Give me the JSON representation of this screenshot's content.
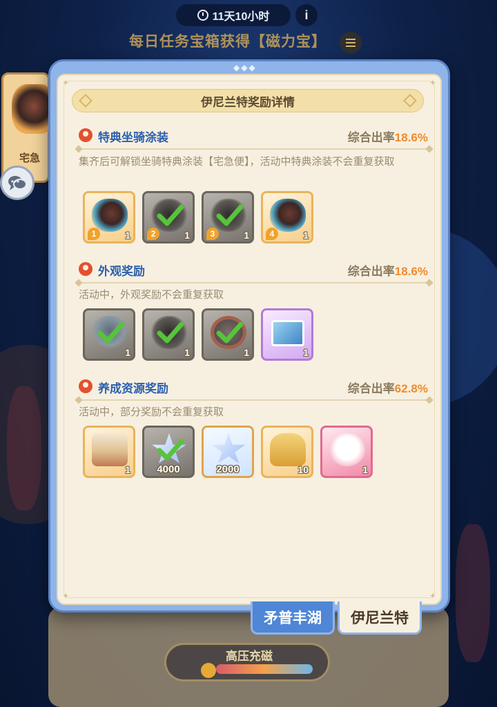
{
  "background": {
    "timer": "11天10小时",
    "info_glyph": "i",
    "title": "每日任务宝箱获得【磁力宝】",
    "side_card_label": "宅急",
    "bottom_button_label": "高压充磁"
  },
  "modal": {
    "title": "伊尼兰特奖励详情",
    "sections": [
      {
        "title": "特典坐骑涂装",
        "rate_label": "综合出率",
        "rate_value": "18.6%",
        "description": "集齐后可解锁坐骑特典涂装【宅急便】，活动中特典涂装不会重复获取",
        "items": [
          {
            "count": "1",
            "index": "1",
            "owned": false
          },
          {
            "count": "1",
            "index": "2",
            "owned": true
          },
          {
            "count": "1",
            "index": "3",
            "owned": true
          },
          {
            "count": "1",
            "index": "4",
            "owned": false
          }
        ]
      },
      {
        "title": "外观奖励",
        "rate_label": "综合出率",
        "rate_value": "18.6%",
        "description": "活动中，外观奖励不会重复获取",
        "items": [
          {
            "count": "1",
            "owned": true
          },
          {
            "count": "1",
            "owned": true
          },
          {
            "count": "1",
            "owned": true
          },
          {
            "count": "1",
            "owned": false
          }
        ]
      },
      {
        "title": "养成资源奖励",
        "rate_label": "综合出率",
        "rate_value": "62.8%",
        "description": "活动中，部分奖励不会重复获取",
        "items": [
          {
            "count": "1",
            "owned": false
          },
          {
            "count": "4000",
            "owned": true
          },
          {
            "count": "2000",
            "owned": false
          },
          {
            "count": "10",
            "owned": false
          },
          {
            "count": "1",
            "owned": false
          }
        ]
      }
    ]
  },
  "tabs": [
    {
      "label": "矛普丰湖",
      "active": false
    },
    {
      "label": "伊尼兰特",
      "active": true
    }
  ],
  "colors": {
    "rate_orange": "#f08a2a",
    "section_blue": "#2c5fae",
    "frame_blue": "#8fb4ea",
    "check_green": "#57c43a"
  }
}
